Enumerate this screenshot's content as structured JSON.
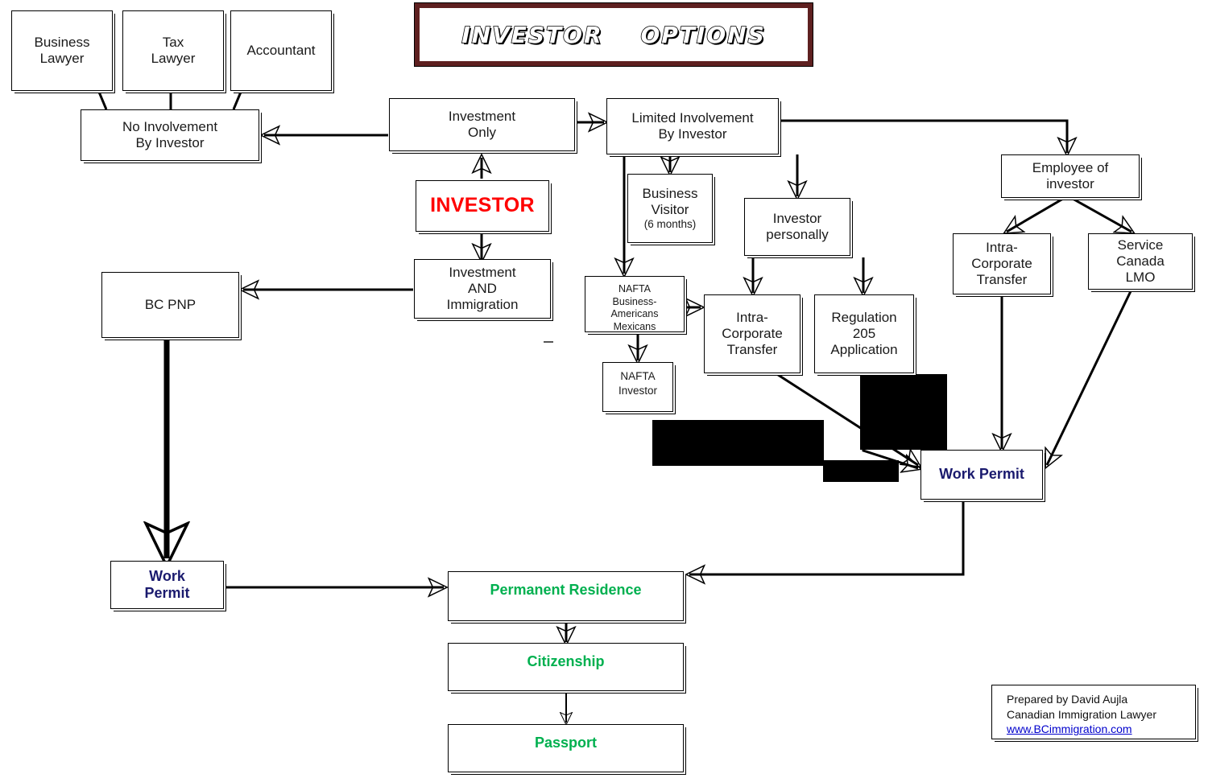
{
  "title": {
    "text": "INVESTOR    OPTIONS",
    "frame_color": "#5e2020"
  },
  "colors": {
    "accent_red": "#ff0000",
    "accent_navy": "#1a1a6e",
    "accent_green": "#00b04f",
    "link_blue": "#0000cc",
    "border": "#000000"
  },
  "nodes": {
    "business_lawyer": {
      "label": "Business\nLawyer"
    },
    "tax_lawyer": {
      "label": "Tax\nLawyer"
    },
    "accountant": {
      "label": "Accountant"
    },
    "no_involvement": {
      "label": "No Involvement\nBy Investor"
    },
    "investment_only": {
      "label": "Investment\nOnly"
    },
    "limited_involvement": {
      "label": "Limited Involvement\nBy Investor"
    },
    "investor": {
      "label": "INVESTOR"
    },
    "business_visitor": {
      "label": "Business\nVisitor",
      "sub": "(6 months)"
    },
    "investor_personally": {
      "label": "Investor\npersonally"
    },
    "employee_of_investor": {
      "label": "Employee of\ninvestor"
    },
    "investment_and_immigration": {
      "label": "Investment\nAND\nImmigration"
    },
    "bc_pnp": {
      "label": "BC PNP"
    },
    "nafta_business": {
      "label": "NAFTA\nBusiness-\nAmericans\nMexicans"
    },
    "nafta_investor": {
      "label": "NAFTA\nInvestor"
    },
    "intra_corporate_mid": {
      "label": "Intra-\nCorporate\nTransfer"
    },
    "regulation_205": {
      "label": "Regulation\n205\nApplication"
    },
    "intra_corporate_right": {
      "label": "Intra-\nCorporate\nTransfer"
    },
    "service_canada_lmo": {
      "label": "Service\nCanada\nLMO"
    },
    "work_permit_right": {
      "label": "Work Permit"
    },
    "work_permit_left": {
      "label": "Work\nPermit"
    },
    "permanent_residence": {
      "label": "Permanent Residence"
    },
    "citizenship": {
      "label": "Citizenship"
    },
    "passport": {
      "label": "Passport"
    }
  },
  "credit": {
    "line1": "Prepared by David Aujla",
    "line2": "Canadian Immigration Lawyer",
    "link": "www.BCimmigration.com"
  },
  "chart_data": {
    "type": "diagram",
    "title": "INVESTOR    OPTIONS",
    "edges": [
      {
        "from": "business_lawyer",
        "to": "no_involvement"
      },
      {
        "from": "tax_lawyer",
        "to": "no_involvement"
      },
      {
        "from": "accountant",
        "to": "no_involvement"
      },
      {
        "from": "investment_only",
        "to": "no_involvement"
      },
      {
        "from": "investment_only",
        "to": "limited_involvement"
      },
      {
        "from": "investor",
        "to": "investment_only"
      },
      {
        "from": "investor",
        "to": "investment_and_immigration"
      },
      {
        "from": "investment_and_immigration",
        "to": "bc_pnp"
      },
      {
        "from": "bc_pnp",
        "to": "work_permit_left"
      },
      {
        "from": "work_permit_left",
        "to": "permanent_residence"
      },
      {
        "from": "limited_involvement",
        "to": "business_visitor"
      },
      {
        "from": "limited_involvement",
        "to": "nafta_business"
      },
      {
        "from": "limited_involvement",
        "to": "investor_personally"
      },
      {
        "from": "limited_involvement",
        "to": "employee_of_investor"
      },
      {
        "from": "nafta_business",
        "to": "nafta_investor"
      },
      {
        "from": "nafta_business",
        "to": "intra_corporate_mid"
      },
      {
        "from": "investor_personally",
        "to": "intra_corporate_mid"
      },
      {
        "from": "investor_personally",
        "to": "regulation_205"
      },
      {
        "from": "intra_corporate_mid",
        "to": "work_permit_right"
      },
      {
        "from": "regulation_205",
        "to": "work_permit_right"
      },
      {
        "from": "employee_of_investor",
        "to": "intra_corporate_right"
      },
      {
        "from": "employee_of_investor",
        "to": "service_canada_lmo"
      },
      {
        "from": "intra_corporate_right",
        "to": "work_permit_right"
      },
      {
        "from": "service_canada_lmo",
        "to": "work_permit_right"
      },
      {
        "from": "work_permit_right",
        "to": "permanent_residence"
      },
      {
        "from": "permanent_residence",
        "to": "citizenship"
      },
      {
        "from": "citizenship",
        "to": "passport"
      }
    ]
  }
}
